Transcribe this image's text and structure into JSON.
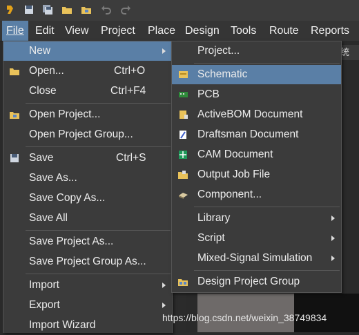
{
  "toolbar": {
    "icons": [
      "app-logo-icon",
      "save-icon",
      "save-all-icon",
      "open-folder-icon",
      "open-project-icon",
      "undo-icon",
      "redo-icon"
    ]
  },
  "menubar": {
    "items": [
      "File",
      "Edit",
      "View",
      "Project",
      "Place",
      "Design",
      "Tools",
      "Route",
      "Reports"
    ]
  },
  "file_menu": {
    "items": [
      {
        "label": "New",
        "shortcut": "",
        "submenu": true
      },
      {
        "label": "Open...",
        "shortcut": "Ctrl+O"
      },
      {
        "label": "Close",
        "shortcut": "Ctrl+F4"
      },
      {
        "label": "Open Project..."
      },
      {
        "label": "Open Project Group..."
      },
      {
        "label": "Save",
        "shortcut": "Ctrl+S"
      },
      {
        "label": "Save As..."
      },
      {
        "label": "Save Copy As..."
      },
      {
        "label": "Save All"
      },
      {
        "label": "Save Project As..."
      },
      {
        "label": "Save Project Group As..."
      },
      {
        "label": "Import",
        "submenu": true
      },
      {
        "label": "Export",
        "submenu": true
      },
      {
        "label": "Import Wizard"
      }
    ]
  },
  "new_submenu": {
    "items": [
      {
        "label": "Project..."
      },
      {
        "label": "Schematic"
      },
      {
        "label": "PCB"
      },
      {
        "label": "ActiveBOM Document"
      },
      {
        "label": "Draftsman Document"
      },
      {
        "label": "CAM Document"
      },
      {
        "label": "Output Job File"
      },
      {
        "label": "Component..."
      },
      {
        "label": "Library",
        "submenu": true
      },
      {
        "label": "Script",
        "submenu": true
      },
      {
        "label": "Mixed-Signal Simulation",
        "submenu": true
      },
      {
        "label": "Design Project Group"
      }
    ]
  },
  "background": {
    "tab_text": "统"
  },
  "watermark": "https://blog.csdn.net/weixin_38749834",
  "colors": {
    "highlight": "#5a7fa6",
    "menu_bg": "#3b3b3b"
  }
}
